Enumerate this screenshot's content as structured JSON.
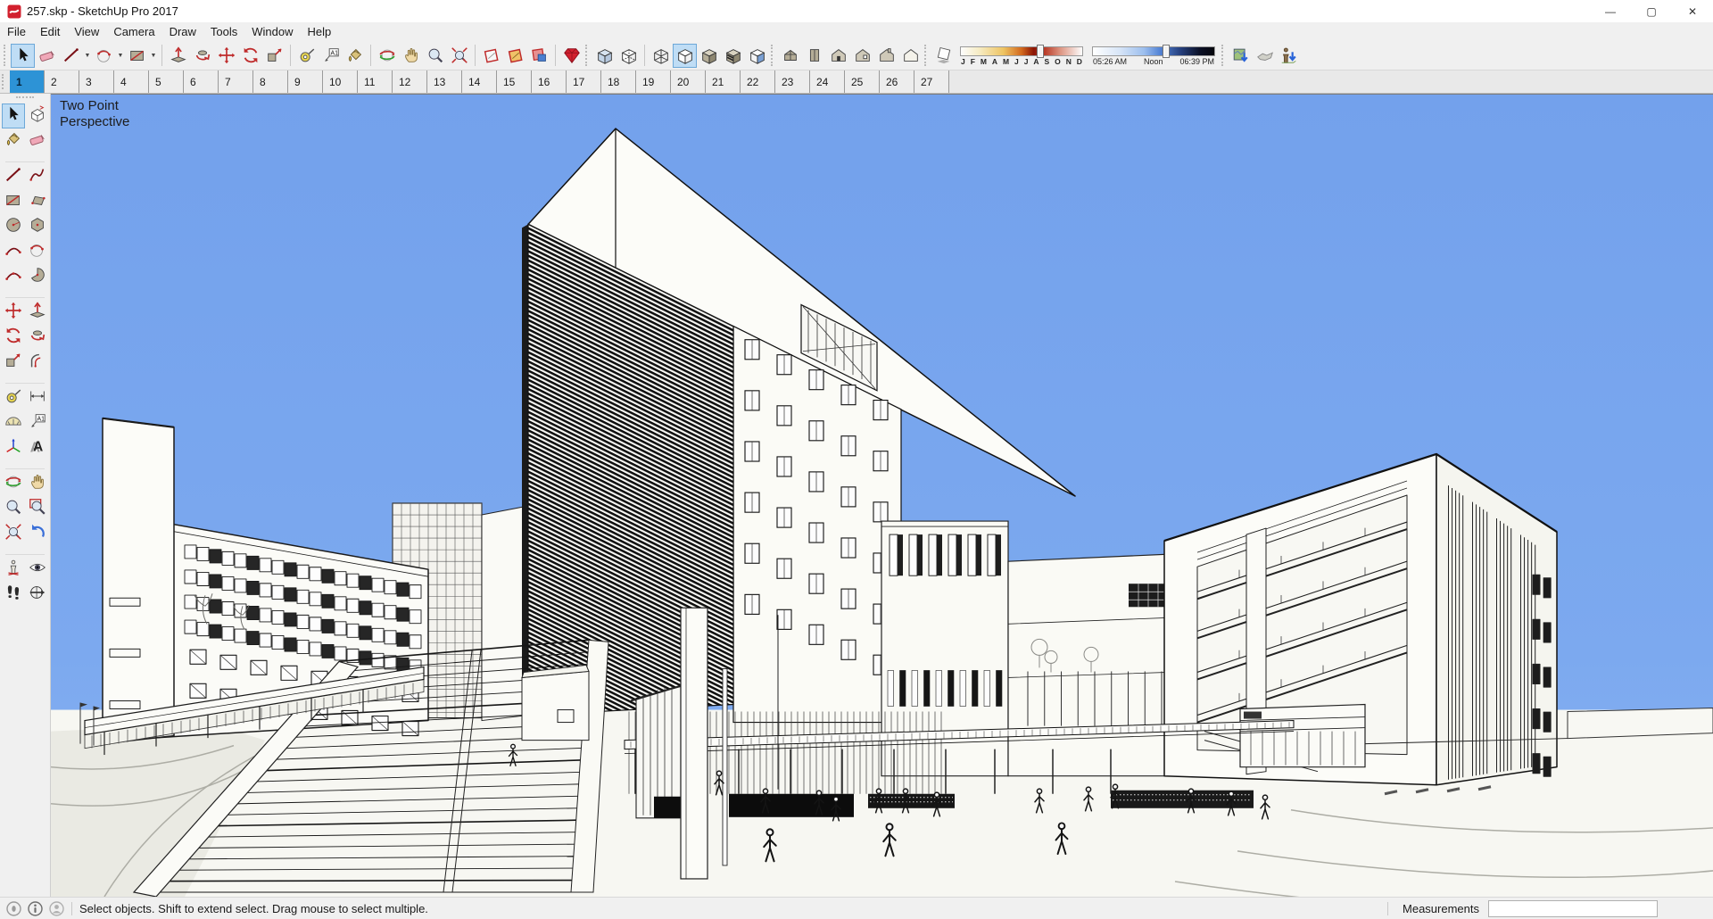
{
  "window": {
    "title": "257.skp - SketchUp Pro 2017",
    "controls": [
      {
        "name": "minimize",
        "glyph": "—"
      },
      {
        "name": "maximize",
        "glyph": "▢"
      },
      {
        "name": "close",
        "glyph": "✕"
      }
    ]
  },
  "menu": {
    "items": [
      "File",
      "Edit",
      "View",
      "Camera",
      "Draw",
      "Tools",
      "Window",
      "Help"
    ]
  },
  "toolbar": {
    "groups": [
      {
        "grip": true,
        "icons": [
          {
            "name": "select",
            "active": true
          },
          {
            "name": "eraser"
          },
          {
            "name": "line",
            "dropdown": true
          },
          {
            "name": "arc",
            "dropdown": true
          },
          {
            "name": "rectangle",
            "dropdown": true
          }
        ]
      },
      {
        "icons": [
          {
            "name": "push-pull"
          },
          {
            "name": "follow-me"
          },
          {
            "name": "move"
          },
          {
            "name": "rotate"
          },
          {
            "name": "scale"
          }
        ]
      },
      {
        "icons": [
          {
            "name": "tape-measure"
          },
          {
            "name": "text"
          },
          {
            "name": "paint-bucket"
          }
        ]
      },
      {
        "icons": [
          {
            "name": "orbit"
          },
          {
            "name": "pan"
          },
          {
            "name": "zoom"
          },
          {
            "name": "zoom-extents"
          }
        ]
      },
      {
        "icons": [
          {
            "name": "section-plane"
          },
          {
            "name": "display-section-planes"
          },
          {
            "name": "display-section-cuts"
          }
        ]
      },
      {
        "icons": [
          {
            "name": "ruby-gem"
          }
        ]
      },
      {
        "grip": true,
        "icons": [
          {
            "name": "x-ray"
          },
          {
            "name": "back-edges"
          }
        ]
      },
      {
        "icons": [
          {
            "name": "wireframe"
          },
          {
            "name": "hidden-line",
            "active": true
          },
          {
            "name": "shaded"
          },
          {
            "name": "shaded-with-textures"
          },
          {
            "name": "monochrome"
          }
        ]
      },
      {
        "grip": true,
        "icons": [
          {
            "name": "view-iso"
          },
          {
            "name": "view-top"
          },
          {
            "name": "view-front"
          },
          {
            "name": "view-right"
          },
          {
            "name": "view-back"
          },
          {
            "name": "view-left"
          }
        ]
      },
      {
        "grip": true,
        "icons": [
          {
            "name": "shadow-settings"
          }
        ],
        "sliders": true
      },
      {
        "grip": true,
        "icons": [
          {
            "name": "add-location"
          },
          {
            "name": "toggle-terrain"
          },
          {
            "name": "add-building"
          }
        ]
      }
    ]
  },
  "shadows": {
    "months": [
      "J",
      "F",
      "M",
      "A",
      "M",
      "J",
      "J",
      "A",
      "S",
      "O",
      "N",
      "D"
    ],
    "date_percent": 62,
    "time_start": "05:26 AM",
    "time_mid": "Noon",
    "time_end": "06:39 PM",
    "time_percent": 57
  },
  "scene_tabs": {
    "tabs": [
      "1",
      "2",
      "3",
      "4",
      "5",
      "6",
      "7",
      "8",
      "9",
      "10",
      "11",
      "12",
      "13",
      "14",
      "15",
      "16",
      "17",
      "18",
      "19",
      "20",
      "21",
      "22",
      "23",
      "24",
      "25",
      "26",
      "27"
    ],
    "active_index": 0
  },
  "left_toolbar": {
    "items": [
      [
        "select",
        "make-component"
      ],
      [
        "paint-bucket",
        "eraser"
      ],
      "div",
      [
        "line",
        "freehand"
      ],
      [
        "rectangle",
        "rotated-rectangle"
      ],
      [
        "circle",
        "polygon"
      ],
      [
        "two-point-arc",
        "arc"
      ],
      [
        "three-point-arc",
        "pie"
      ],
      "div",
      [
        "move",
        "push-pull"
      ],
      [
        "rotate",
        "follow-me"
      ],
      [
        "scale",
        "offset"
      ],
      "div",
      [
        "tape-measure",
        "dimension"
      ],
      [
        "protractor",
        "text"
      ],
      [
        "axes",
        "3d-text"
      ],
      "div",
      [
        "orbit",
        "pan"
      ],
      [
        "zoom",
        "zoom-window"
      ],
      [
        "zoom-extents",
        "previous"
      ],
      "div",
      [
        "position-camera",
        "look-around"
      ],
      [
        "walk",
        "section-plane-tool"
      ]
    ],
    "active": "select"
  },
  "viewport": {
    "label_line1": "Two Point",
    "label_line2": "Perspective",
    "sky_color": "#78a5ee"
  },
  "status_bar": {
    "icons": [
      "geolocation-icon",
      "credits-icon",
      "user-icon"
    ],
    "message": "Select objects. Shift to extend select. Drag mouse to select multiple.",
    "measurements_label": "Measurements",
    "measurements_value": ""
  }
}
